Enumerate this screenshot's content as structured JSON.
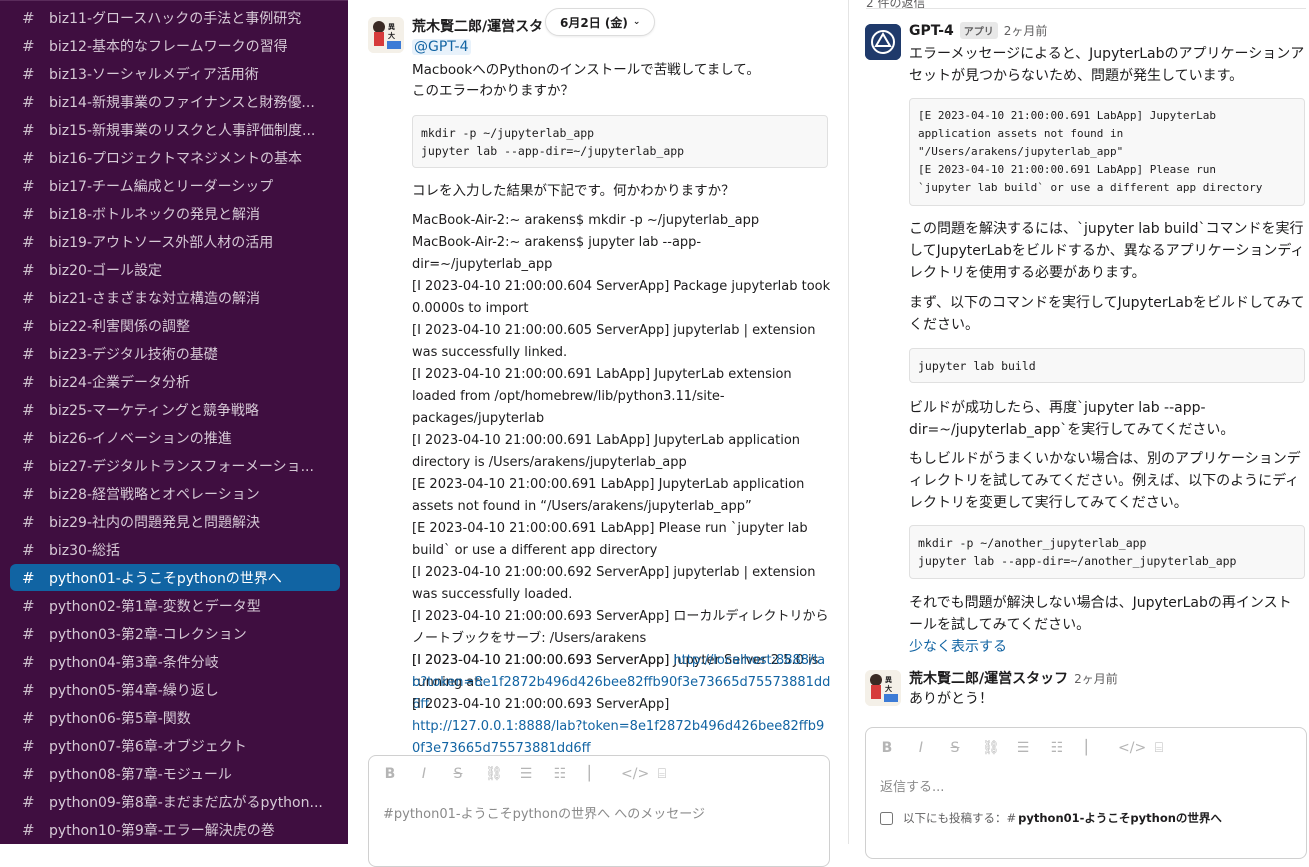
{
  "sidebar": {
    "channels": [
      {
        "name": "biz11-グロースハックの手法と事例研究"
      },
      {
        "name": "biz12-基本的なフレームワークの習得"
      },
      {
        "name": "biz13-ソーシャルメディア活用術"
      },
      {
        "name": "biz14-新規事業のファイナンスと財務優..."
      },
      {
        "name": "biz15-新規事業のリスクと人事評価制度..."
      },
      {
        "name": "biz16-プロジェクトマネジメントの基本"
      },
      {
        "name": "biz17-チーム編成とリーダーシップ"
      },
      {
        "name": "biz18-ボトルネックの発見と解消"
      },
      {
        "name": "biz19-アウトソース外部人材の活用"
      },
      {
        "name": "biz20-ゴール設定"
      },
      {
        "name": "biz21-さまざまな対立構造の解消"
      },
      {
        "name": "biz22-利害関係の調整"
      },
      {
        "name": "biz23-デジタル技術の基礎"
      },
      {
        "name": "biz24-企業データ分析"
      },
      {
        "name": "biz25-マーケティングと競争戦略"
      },
      {
        "name": "biz26-イノベーションの推進"
      },
      {
        "name": "biz27-デジタルトランスフォーメーショ..."
      },
      {
        "name": "biz28-経営戦略とオペレーション"
      },
      {
        "name": "biz29-社内の問題発見と問題解決"
      },
      {
        "name": "biz30-総括"
      },
      {
        "name": "python01-ようこそpythonの世界へ",
        "active": true
      },
      {
        "name": "python02-第1章-変数とデータ型"
      },
      {
        "name": "python03-第2章-コレクション"
      },
      {
        "name": "python04-第3章-条件分岐"
      },
      {
        "name": "python05-第4章-繰り返し"
      },
      {
        "name": "python06-第5章-関数"
      },
      {
        "name": "python07-第6章-オブジェクト"
      },
      {
        "name": "python08-第7章-モジュール"
      },
      {
        "name": "python09-第8章-まだまだ広がるpython..."
      },
      {
        "name": "python10-第9章-エラー解決虎の巻"
      }
    ],
    "active_color": "#1164a3",
    "background_color": "#3f0e40"
  },
  "main": {
    "author": "荒木賢二郎/運営スタ",
    "date_pill": "6月2日 (金)",
    "mention": "@GPT-4",
    "line1": "MacbookへのPythonのインストールで苦戦してまして。",
    "line2": "このエラーわかりますか？",
    "code1": "mkdir -p ~/jupyterlab_app\njupyter lab --app-dir=~/jupyterlab_app",
    "line3": "コレを入力した結果が下記です。何かわかりますか？",
    "log": [
      "MacBook-Air-2:~ arakens$ mkdir -p ~/jupyterlab_app",
      "MacBook-Air-2:~ arakens$ jupyter lab --app-dir=~/jupyterlab_app",
      "[I 2023-04-10 21:00:00.604 ServerApp] Package jupyterlab took 0.0000s to import",
      "[I 2023-04-10 21:00:00.605 ServerApp] jupyterlab | extension was successfully linked.",
      "[I 2023-04-10 21:00:00.691 LabApp] JupyterLab extension loaded from /opt/homebrew/lib/python3.11/site-packages/jupyterlab",
      "[I 2023-04-10 21:00:00.691 LabApp] JupyterLab application directory is /Users/arakens/jupyterlab_app",
      "[E 2023-04-10 21:00:00.691 LabApp] JupyterLab application assets not found in “/Users/arakens/jupyterlab_app”",
      "[E 2023-04-10 21:00:00.691 LabApp] Please run `jupyter lab build` or use a different app directory",
      "[I 2023-04-10 21:00:00.692 ServerApp] jupyterlab | extension was successfully loaded.",
      "[I 2023-04-10 21:00:00.693 ServerApp] ローカルディレクトリからノートブックをサーブ: /Users/arakens",
      "[I 2023-04-10 21:00:00.693 ServerApp] Jupyter Server 2.5.0 is running at:"
    ],
    "log_link_prefix": "[I 2023-04-10 21:00:00.693 ServerApp]",
    "log_link1": "http://localhost:8888/lab?token=8e1f2872b496d426bee82ffb90f3e73665d75573881dd6ff",
    "log_link2": "http://127.0.0.1:8888/lab?token=8e1f2872b496d426bee82ffb90f3e73665d75573881dd6ff",
    "composer_placeholder": "#python01-ようこそpythonの世界へ へのメッセージ"
  },
  "thread": {
    "reply_count": "2 件の返信",
    "bot_name": "GPT-4",
    "bot_badge": "アプリ",
    "bot_time": "2ヶ月前",
    "p1": "エラーメッセージによると、JupyterLabのアプリケーションアセットが見つからないため、問題が発生しています。",
    "code1": "[E 2023-04-10 21:00:00.691 LabApp] JupyterLab\napplication assets not found in\n\"/Users/arakens/jupyterlab_app\"\n[E 2023-04-10 21:00:00.691 LabApp] Please run\n`jupyter lab build` or use a different app directory",
    "p2": "この問題を解決するには、`jupyter lab build`コマンドを実行してJupyterLabをビルドするか、異なるアプリケーションディレクトリを使用する必要があります。",
    "p3": "まず、以下のコマンドを実行してJupyterLabをビルドしてみてください。",
    "code2": "jupyter lab build",
    "p4": "ビルドが成功したら、再度`jupyter lab --app-dir=~/jupyterlab_app`を実行してみてください。",
    "p5": "もしビルドがうまくいかない場合は、別のアプリケーションディレクトリを試してみてください。例えば、以下のようにディレクトリを変更して実行してみてください。",
    "code3": "mkdir -p ~/another_jupyterlab_app\njupyter lab --app-dir=~/another_jupyterlab_app",
    "p6": "それでも問題が解決しない場合は、JupyterLabの再インストールを試してみてください。",
    "show_less": "少なく表示する",
    "reply2_author": "荒木賢二郎/運営スタッフ",
    "reply2_time": "2ヶ月前",
    "reply2_text": "ありがとう！",
    "composer_placeholder": "返信する...",
    "also_post_label": "以下にも投稿する：#",
    "also_post_channel": "python01-ようこそpythonの世界へ"
  }
}
